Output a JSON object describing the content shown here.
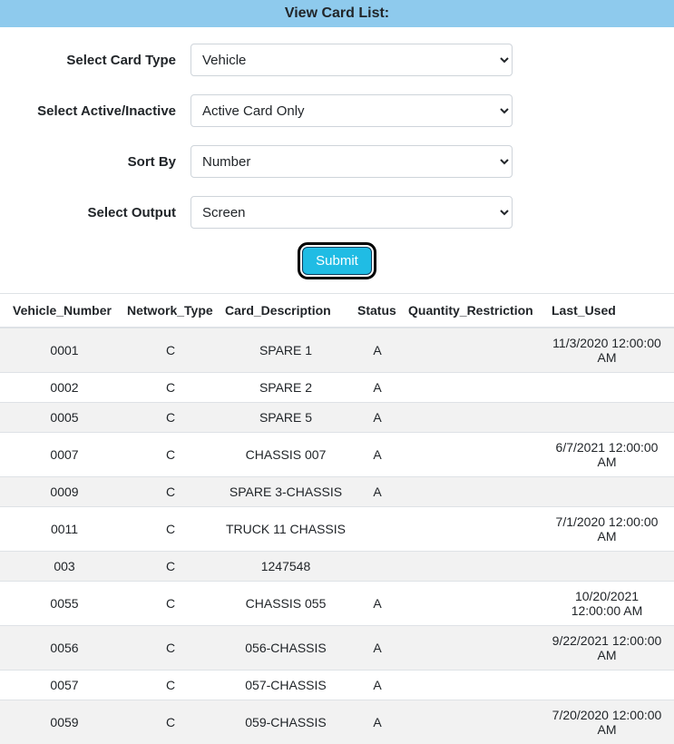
{
  "header": {
    "title": "View Card List:"
  },
  "form": {
    "card_type": {
      "label": "Select Card Type",
      "selected": "Vehicle"
    },
    "active": {
      "label": "Select Active/Inactive",
      "selected": "Active Card Only"
    },
    "sort_by": {
      "label": "Sort By",
      "selected": "Number"
    },
    "output": {
      "label": "Select Output",
      "selected": "Screen"
    },
    "submit_label": "Submit"
  },
  "table": {
    "columns": {
      "vehicle_number": "Vehicle_Number",
      "network_type": "Network_Type",
      "card_description": "Card_Description",
      "status": "Status",
      "quantity_restriction": "Quantity_Restriction",
      "last_used": "Last_Used"
    },
    "rows": [
      {
        "vehicle_number": "0001",
        "network_type": "C",
        "card_description": "SPARE 1",
        "status": "A",
        "quantity_restriction": "",
        "last_used": "11/3/2020 12:00:00 AM"
      },
      {
        "vehicle_number": "0002",
        "network_type": "C",
        "card_description": "SPARE 2",
        "status": "A",
        "quantity_restriction": "",
        "last_used": ""
      },
      {
        "vehicle_number": "0005",
        "network_type": "C",
        "card_description": "SPARE 5",
        "status": "A",
        "quantity_restriction": "",
        "last_used": ""
      },
      {
        "vehicle_number": "0007",
        "network_type": "C",
        "card_description": "CHASSIS 007",
        "status": "A",
        "quantity_restriction": "",
        "last_used": "6/7/2021 12:00:00 AM"
      },
      {
        "vehicle_number": "0009",
        "network_type": "C",
        "card_description": "SPARE 3-CHASSIS",
        "status": "A",
        "quantity_restriction": "",
        "last_used": ""
      },
      {
        "vehicle_number": "0011",
        "network_type": "C",
        "card_description": "TRUCK 11 CHASSIS",
        "status": "",
        "quantity_restriction": "",
        "last_used": "7/1/2020 12:00:00 AM"
      },
      {
        "vehicle_number": "003",
        "network_type": "C",
        "card_description": "1247548",
        "status": "",
        "quantity_restriction": "",
        "last_used": ""
      },
      {
        "vehicle_number": "0055",
        "network_type": "C",
        "card_description": "CHASSIS 055",
        "status": "A",
        "quantity_restriction": "",
        "last_used": "10/20/2021 12:00:00 AM"
      },
      {
        "vehicle_number": "0056",
        "network_type": "C",
        "card_description": "056-CHASSIS",
        "status": "A",
        "quantity_restriction": "",
        "last_used": "9/22/2021 12:00:00 AM"
      },
      {
        "vehicle_number": "0057",
        "network_type": "C",
        "card_description": "057-CHASSIS",
        "status": "A",
        "quantity_restriction": "",
        "last_used": ""
      },
      {
        "vehicle_number": "0059",
        "network_type": "C",
        "card_description": "059-CHASSIS",
        "status": "A",
        "quantity_restriction": "",
        "last_used": "7/20/2020 12:00:00 AM"
      }
    ]
  }
}
